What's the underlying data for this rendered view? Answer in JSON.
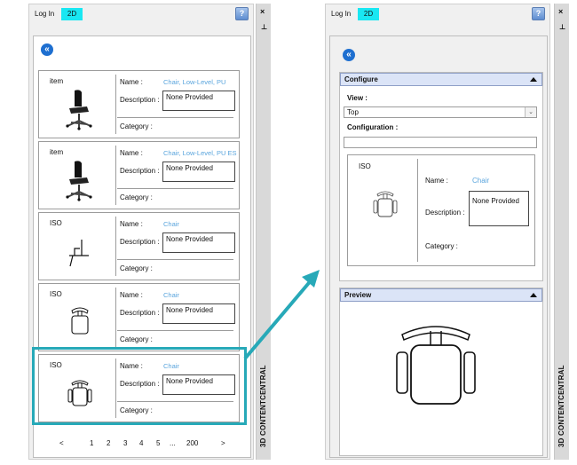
{
  "left_panel": {
    "tabs": [
      "Log In",
      "2D"
    ],
    "help_label": "?",
    "back_label": "«",
    "cards": [
      {
        "kind": "item",
        "name_label": "Name :",
        "name_value": "Chair, Low-Level, PU",
        "desc_label": "Description :",
        "desc_value": "None Provided",
        "category_label": "Category :"
      },
      {
        "kind": "item",
        "name_label": "Name :",
        "name_value": "Chair, Low-Level, PU ES",
        "desc_label": "Description :",
        "desc_value": "None Provided",
        "category_label": "Category :"
      },
      {
        "kind": "ISO",
        "name_label": "Name :",
        "name_value": "Chair",
        "desc_label": "Description :",
        "desc_value": "None Provided",
        "category_label": "Category :"
      },
      {
        "kind": "ISO",
        "name_label": "Name :",
        "name_value": "Chair",
        "desc_label": "Description :",
        "desc_value": "None Provided",
        "category_label": "Category :"
      },
      {
        "kind": "ISO",
        "name_label": "Name :",
        "name_value": "Chair",
        "desc_label": "Description :",
        "desc_value": "None Provided",
        "category_label": "Category :"
      }
    ],
    "pager": {
      "prev": "<",
      "pages": [
        "1",
        "2",
        "3",
        "4",
        "5"
      ],
      "ellipsis": "...",
      "last": "200",
      "next": ">"
    },
    "sidebar": {
      "close": "×",
      "pin": "⊥",
      "title": "3D CONTENTCENTRAL"
    }
  },
  "right_panel": {
    "tabs": [
      "Log In",
      "2D"
    ],
    "help_label": "?",
    "back_label": "«",
    "configure": {
      "title": "Configure",
      "view_label": "View :",
      "view_value": "Top",
      "configuration_label": "Configuration :",
      "configuration_value": "",
      "card": {
        "kind": "ISO",
        "name_label": "Name :",
        "name_value": "Chair",
        "desc_label": "Description :",
        "desc_value": "None Provided",
        "category_label": "Category :"
      }
    },
    "preview": {
      "title": "Preview"
    },
    "sidebar": {
      "close": "×",
      "pin": "⊥",
      "title": "3D CONTENTCENTRAL"
    }
  },
  "colors": {
    "highlight": "#27a9b8",
    "tab_active": "#19e7f2",
    "link_value": "#5aa5dd",
    "section_header": "#dbe4f7"
  }
}
